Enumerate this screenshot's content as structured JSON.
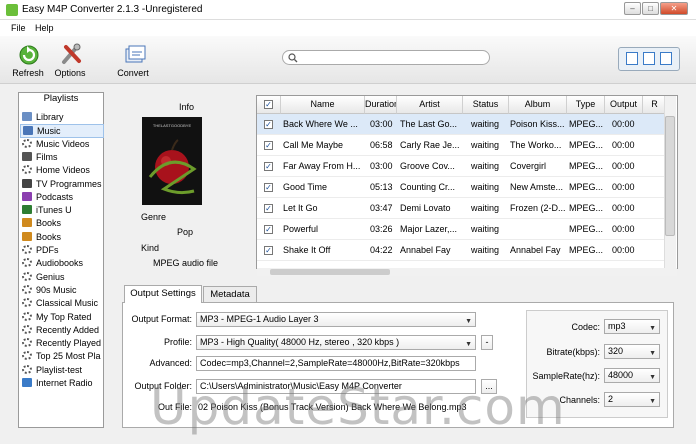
{
  "window": {
    "title": "Easy M4P Converter 2.1.3 -Unregistered"
  },
  "menu": {
    "items": [
      "File",
      "Help"
    ]
  },
  "toolbar": {
    "refresh": "Refresh",
    "options": "Options",
    "convert": "Convert"
  },
  "search": {
    "placeholder": ""
  },
  "sidebar": {
    "header": "Playlists",
    "items": [
      {
        "label": "Library",
        "icon": "library-icon"
      },
      {
        "label": "Music",
        "icon": "music-note-icon",
        "selected": true
      },
      {
        "label": "Music Videos",
        "icon": "gear-icon"
      },
      {
        "label": "Films",
        "icon": "film-icon"
      },
      {
        "label": "Home Videos",
        "icon": "gear-icon"
      },
      {
        "label": "TV Programmes",
        "icon": "tv-icon"
      },
      {
        "label": "Podcasts",
        "icon": "podcast-icon"
      },
      {
        "label": "iTunes U",
        "icon": "itunes-u-icon"
      },
      {
        "label": "Books",
        "icon": "book-icon"
      },
      {
        "label": "Books",
        "icon": "book-icon"
      },
      {
        "label": "PDFs",
        "icon": "gear-icon"
      },
      {
        "label": "Audiobooks",
        "icon": "gear-icon"
      },
      {
        "label": "Genius",
        "icon": "gear-icon"
      },
      {
        "label": "90s Music",
        "icon": "gear-icon"
      },
      {
        "label": "Classical Music",
        "icon": "gear-icon"
      },
      {
        "label": "My Top Rated",
        "icon": "gear-icon"
      },
      {
        "label": "Recently Added",
        "icon": "gear-icon"
      },
      {
        "label": "Recently Played",
        "icon": "gear-icon"
      },
      {
        "label": "Top 25 Most Pla",
        "icon": "gear-icon"
      },
      {
        "label": "Playlist-test",
        "icon": "gear-icon"
      },
      {
        "label": "Internet Radio",
        "icon": "radio-icon"
      }
    ]
  },
  "info": {
    "header": "Info",
    "genre_label": "Genre",
    "genre_value": "Pop",
    "kind_label": "Kind",
    "kind_value": "MPEG audio file"
  },
  "table": {
    "columns": [
      "Name",
      "Duration",
      "Artist",
      "Status",
      "Album",
      "Type",
      "Output",
      "R"
    ],
    "rows": [
      {
        "name": "Back Where We ...",
        "duration": "03:00",
        "artist": "The Last Go...",
        "status": "waiting",
        "album": "Poison Kiss...",
        "type": "MPEG...",
        "output": "00:00",
        "selected": true
      },
      {
        "name": "Call Me Maybe",
        "duration": "06:58",
        "artist": "Carly Rae Je...",
        "status": "waiting",
        "album": "The Worko...",
        "type": "MPEG...",
        "output": "00:00"
      },
      {
        "name": "Far Away From H...",
        "duration": "03:00",
        "artist": "Groove Cov...",
        "status": "waiting",
        "album": "Covergirl",
        "type": "MPEG...",
        "output": "00:00"
      },
      {
        "name": "Good Time",
        "duration": "05:13",
        "artist": "Counting Cr...",
        "status": "waiting",
        "album": "New Amste...",
        "type": "MPEG...",
        "output": "00:00"
      },
      {
        "name": "Let It Go",
        "duration": "03:47",
        "artist": "Demi Lovato",
        "status": "waiting",
        "album": "Frozen (2-D...",
        "type": "MPEG...",
        "output": "00:00"
      },
      {
        "name": "Powerful",
        "duration": "03:26",
        "artist": "Major Lazer,...",
        "status": "waiting",
        "album": "",
        "type": "MPEG...",
        "output": "00:00"
      },
      {
        "name": "Shake It Off",
        "duration": "04:22",
        "artist": "Annabel Fay",
        "status": "waiting",
        "album": "Annabel Fay",
        "type": "MPEG...",
        "output": "00:00"
      }
    ]
  },
  "tabs": {
    "output_settings": "Output Settings",
    "metadata": "Metadata"
  },
  "settings": {
    "output_format_label": "Output Format:",
    "output_format_value": "MP3 - MPEG-1 Audio Layer 3",
    "profile_label": "Profile:",
    "profile_value": "MP3 - High Quality( 48000 Hz, stereo , 320 kbps  )",
    "profile_btn": "-",
    "advanced_label": "Advanced:",
    "advanced_value": "Codec=mp3,Channel=2,SampleRate=48000Hz,BitRate=320kbps",
    "output_folder_label": "Output Folder:",
    "output_folder_value": "C:\\Users\\Administrator\\Music\\Easy M4P Converter",
    "output_folder_btn": "...",
    "output_file_label": "Out File:",
    "output_file_value": "02 Poison Kiss (Bonus Track Version) Back Where We Belong.mp3",
    "codec_label": "Codec:",
    "codec_value": "mp3",
    "bitrate_label": "Bitrate(kbps):",
    "bitrate_value": "320",
    "samplerate_label": "SampleRate(hz):",
    "samplerate_value": "48000",
    "channels_label": "Channels:",
    "channels_value": "2"
  },
  "watermark": "UpdateStar.com",
  "colors": {
    "accent": "#3a7bc8",
    "selected_row": "#dce9f8"
  }
}
